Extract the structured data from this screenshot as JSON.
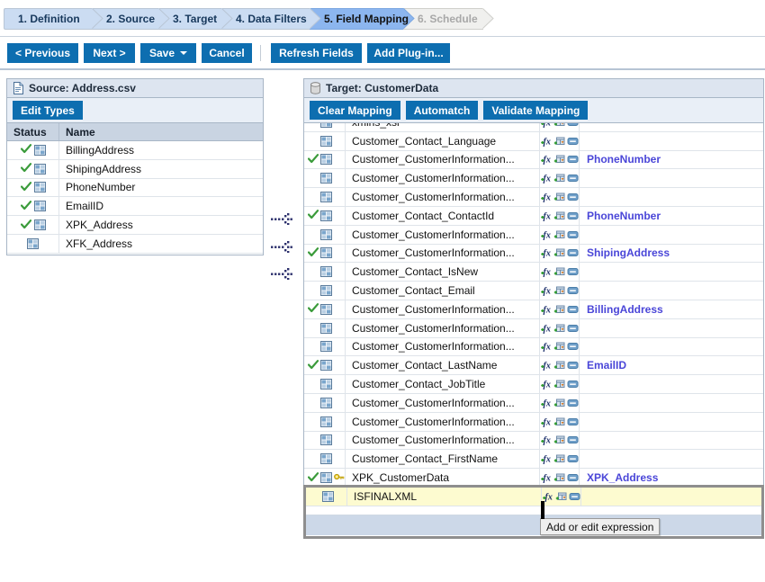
{
  "wizard": {
    "steps": [
      {
        "label": "1. Definition",
        "state": "done"
      },
      {
        "label": "2. Source",
        "state": "done"
      },
      {
        "label": "3. Target",
        "state": "done"
      },
      {
        "label": "4. Data Filters",
        "state": "done"
      },
      {
        "label": "5. Field Mapping",
        "state": "active"
      },
      {
        "label": "6. Schedule",
        "state": "todo"
      }
    ]
  },
  "toolbar": {
    "previous_label": "< Previous",
    "next_label": "Next >",
    "save_label": "Save",
    "cancel_label": "Cancel",
    "refresh_label": "Refresh Fields",
    "add_plugin_label": "Add Plug-in..."
  },
  "source_panel": {
    "title": "Source: Address.csv",
    "edit_types_label": "Edit Types",
    "columns": [
      "Status",
      "Name"
    ],
    "rows": [
      {
        "name": "BillingAddress",
        "mapped": true
      },
      {
        "name": "ShipingAddress",
        "mapped": true
      },
      {
        "name": "PhoneNumber",
        "mapped": true
      },
      {
        "name": "EmailID",
        "mapped": true
      },
      {
        "name": "XPK_Address",
        "mapped": true
      },
      {
        "name": "XFK_Address",
        "mapped": false
      }
    ]
  },
  "target_panel": {
    "title": "Target: CustomerData",
    "clear_mapping_label": "Clear Mapping",
    "automatch_label": "Automatch",
    "validate_mapping_label": "Validate Mapping",
    "rows": [
      {
        "name": "xmlns_xsi",
        "mapped": false,
        "key": false,
        "value": ""
      },
      {
        "name": "Customer_Contact_Language",
        "mapped": false,
        "key": false,
        "value": ""
      },
      {
        "name": "Customer_CustomerInformation...",
        "mapped": true,
        "key": false,
        "value": "PhoneNumber"
      },
      {
        "name": "Customer_CustomerInformation...",
        "mapped": false,
        "key": false,
        "value": ""
      },
      {
        "name": "Customer_CustomerInformation...",
        "mapped": false,
        "key": false,
        "value": ""
      },
      {
        "name": "Customer_Contact_ContactId",
        "mapped": true,
        "key": false,
        "value": "PhoneNumber"
      },
      {
        "name": "Customer_CustomerInformation...",
        "mapped": false,
        "key": false,
        "value": ""
      },
      {
        "name": "Customer_CustomerInformation...",
        "mapped": true,
        "key": false,
        "value": "ShipingAddress"
      },
      {
        "name": "Customer_Contact_IsNew",
        "mapped": false,
        "key": false,
        "value": ""
      },
      {
        "name": "Customer_Contact_Email",
        "mapped": false,
        "key": false,
        "value": ""
      },
      {
        "name": "Customer_CustomerInformation...",
        "mapped": true,
        "key": false,
        "value": "BillingAddress"
      },
      {
        "name": "Customer_CustomerInformation...",
        "mapped": false,
        "key": false,
        "value": ""
      },
      {
        "name": "Customer_CustomerInformation...",
        "mapped": false,
        "key": false,
        "value": ""
      },
      {
        "name": "Customer_Contact_LastName",
        "mapped": true,
        "key": false,
        "value": "EmailID"
      },
      {
        "name": "Customer_Contact_JobTitle",
        "mapped": false,
        "key": false,
        "value": ""
      },
      {
        "name": "Customer_CustomerInformation...",
        "mapped": false,
        "key": false,
        "value": ""
      },
      {
        "name": "Customer_CustomerInformation...",
        "mapped": false,
        "key": false,
        "value": ""
      },
      {
        "name": "Customer_CustomerInformation...",
        "mapped": false,
        "key": false,
        "value": ""
      },
      {
        "name": "Customer_Contact_FirstName",
        "mapped": false,
        "key": false,
        "value": ""
      },
      {
        "name": "XPK_CustomerData",
        "mapped": true,
        "key": true,
        "value": "XPK_Address"
      }
    ],
    "highlighted_row": {
      "name": "ISFINALXML",
      "mapped": false,
      "key": false,
      "value": ""
    },
    "row_icons": {
      "expression": "fx-icon",
      "lookup": "lookup-icon",
      "remove": "remove-icon"
    }
  },
  "tooltip": {
    "text": "Add or edit expression"
  },
  "colors": {
    "button_blue": "#0d6eb0",
    "step_active": "#8cb6ef",
    "step_done": "#cbdcf2",
    "mapped_value": "#4a46d8",
    "highlight_row": "#fdfbd0",
    "check_green": "#2f9b2f"
  }
}
